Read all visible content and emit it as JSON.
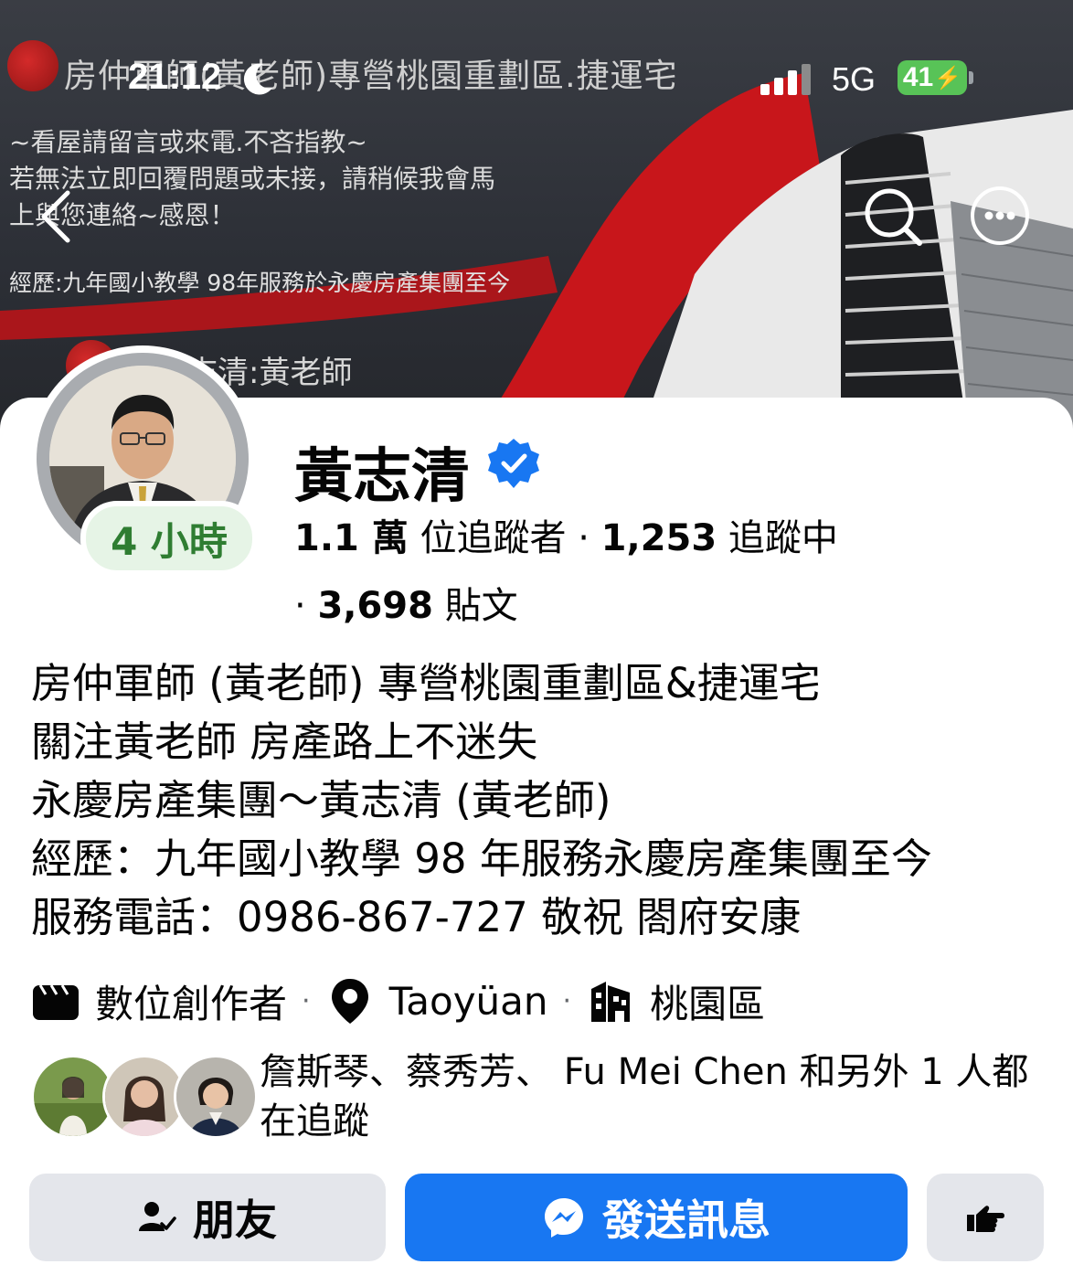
{
  "status_bar": {
    "time": "21:12",
    "network": "5G",
    "battery": "41"
  },
  "cover": {
    "title": "房仲軍師(黃老師)專營桃園重劃區.捷運宅",
    "lines": [
      "~看屋請留言或來電.不吝指教~",
      "若無法立即回覆問題或未接，請稍候我會馬",
      "上與您連絡~感恩！"
    ],
    "experience": "經歷:九年國小教學 98年服務於永慶房產集團至今",
    "name_caption": "黃志清:黃老師"
  },
  "profile": {
    "name": "黃志清",
    "story_age": "4 小時",
    "followers_count": "1.1 萬",
    "followers_label": "位追蹤者",
    "following_count": "1,253",
    "following_label": "追蹤中",
    "posts_count": "3,698",
    "posts_label": "貼文"
  },
  "bio": [
    "房仲軍師 (黃老師) 專營桃園重劃區&捷運宅",
    "關注黃老師 房產路上不迷失",
    "永慶房產集團～黃志清 (黃老師)",
    "經歷：九年國小教學 98 年服務永慶房產集團至今",
    "服務電話：0986-867-727  敬祝 閤府安康"
  ],
  "meta": {
    "category": "數位創作者",
    "location": "Taoyüan",
    "area": "桃園區"
  },
  "mutual": {
    "names": "詹斯琴、蔡秀芳、 Fu Mei Chen",
    "suffix": "和另外 1 人都在追蹤"
  },
  "actions": {
    "friends_label": "朋友",
    "message_label": "發送訊息"
  },
  "colors": {
    "brand_blue": "#1877f2",
    "story_green": "#2f7d32",
    "button_gray": "#e4e6eb"
  }
}
